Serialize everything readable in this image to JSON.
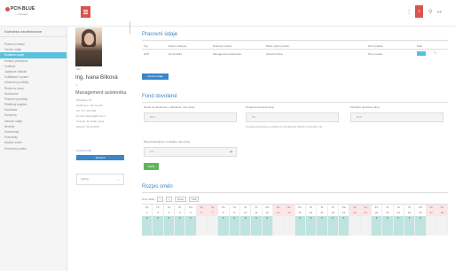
{
  "header": {
    "logo_text": "PCH-BLUE",
    "logo_sub": "software",
    "icons": [
      "grid-icon",
      "bell-icon",
      "user-icon",
      "logout-icon"
    ]
  },
  "sidebar": {
    "title": "Kartoteka zaměstnance",
    "items": [
      {
        "label": "Pracovní vztahy",
        "active": false
      },
      {
        "label": "Osobní údaje",
        "active": false
      },
      {
        "label": "Kontaktní údaje",
        "active": true
      },
      {
        "label": "Rodinní příslušníci",
        "active": false
      },
      {
        "label": "Vzdělání",
        "active": false
      },
      {
        "label": "Jazykové znalosti",
        "active": false
      },
      {
        "label": "Kvalifikace a praxe",
        "active": false
      },
      {
        "label": "Zdravotní prohlídky",
        "active": false
      },
      {
        "label": "Školení a kurzy",
        "active": false
      },
      {
        "label": "Hodnocení",
        "active": false
      },
      {
        "label": "Pracovní pomůcky",
        "active": false
      },
      {
        "label": "Přidělený majetek",
        "active": false
      },
      {
        "label": "Docházka",
        "active": false
      },
      {
        "label": "Dovolená",
        "active": false
      },
      {
        "label": "Mzdové údaje",
        "active": false
      },
      {
        "label": "Benefity",
        "active": false
      },
      {
        "label": "Dokumenty",
        "active": false
      },
      {
        "label": "Poznámky",
        "active": false
      },
      {
        "label": "Historie změn",
        "active": false
      },
      {
        "label": "Ukončení poměru",
        "active": false
      }
    ]
  },
  "profile": {
    "photo_label": "foto",
    "name": "Ing. Ivana Bílková",
    "number": "1",
    "role": "Management asistentka",
    "lines": [
      "Středisko: 01",
      "Nadřízený: Jan Novák",
      "Tel: 777 123 456",
      "E-mail: bilkova@firma.cz",
      "Úvazek: 40 hodin týdně",
      "Nástup: 01.03.2014"
    ],
    "small_link": "Upravit profil",
    "button": "Zobrazit",
    "select_value": "Vybrat"
  },
  "work": {
    "title": "Pracovní údaje",
    "columns": [
      "Typ",
      "Datum nástupu",
      "Pracovní pozice",
      "Místo výkonu práce",
      "Druh úvazku",
      "Stav"
    ],
    "row": [
      "HPP",
      "01.03.2014",
      "Management asistentka",
      "Ústředí Praha",
      "Plný úvazek",
      "aktivní"
    ],
    "button": "Upravit údaje"
  },
  "vacation": {
    "title": "Fond dovolené",
    "field1_label": "Nárok na dovolenou v aktuálním roce (dny)",
    "field1_value": "20,0",
    "field2_label": "Čerpaná dovolená (dny)",
    "field2_value": "5,0",
    "field2_note": "Čerpaná dovolená je počítána ze schválených žádostí za aktuální rok.",
    "field3_label": "Zbývající dovolená (dny)",
    "field3_value": "15,0",
    "field4_label": "Převod dovolené z minulého roku (dny)",
    "field4_value": "0,0",
    "save_button": "Uložit"
  },
  "schedule": {
    "title": "Rozpis směn",
    "month_label": "Únor 2019",
    "prev": "‹",
    "next": "›",
    "today_button": "Dnes",
    "print_button": "Tisk",
    "days": [
      {
        "wd": "Po",
        "d": "1",
        "v": "8",
        "we": false
      },
      {
        "wd": "Út",
        "d": "2",
        "v": "8",
        "we": false
      },
      {
        "wd": "St",
        "d": "3",
        "v": "8",
        "we": false
      },
      {
        "wd": "Čt",
        "d": "4",
        "v": "8",
        "we": false
      },
      {
        "wd": "Pá",
        "d": "5",
        "v": "8",
        "we": false
      },
      {
        "wd": "So",
        "d": "6",
        "v": "",
        "we": true
      },
      {
        "wd": "Ne",
        "d": "7",
        "v": "",
        "we": true
      },
      {
        "wd": "Po",
        "d": "8",
        "v": "8",
        "we": false
      },
      {
        "wd": "Út",
        "d": "9",
        "v": "8",
        "we": false
      },
      {
        "wd": "St",
        "d": "10",
        "v": "8",
        "we": false
      },
      {
        "wd": "Čt",
        "d": "11",
        "v": "8",
        "we": false
      },
      {
        "wd": "Pá",
        "d": "12",
        "v": "8",
        "we": false
      },
      {
        "wd": "So",
        "d": "13",
        "v": "",
        "we": true
      },
      {
        "wd": "Ne",
        "d": "14",
        "v": "",
        "we": true
      },
      {
        "wd": "Po",
        "d": "15",
        "v": "8",
        "we": false
      },
      {
        "wd": "Út",
        "d": "16",
        "v": "8",
        "we": false
      },
      {
        "wd": "St",
        "d": "17",
        "v": "8",
        "we": false
      },
      {
        "wd": "Čt",
        "d": "18",
        "v": "8",
        "we": false
      },
      {
        "wd": "Pá",
        "d": "19",
        "v": "8",
        "we": false
      },
      {
        "wd": "So",
        "d": "20",
        "v": "",
        "we": true
      },
      {
        "wd": "Ne",
        "d": "21",
        "v": "",
        "we": true
      },
      {
        "wd": "Po",
        "d": "22",
        "v": "8",
        "we": false
      },
      {
        "wd": "Út",
        "d": "23",
        "v": "8",
        "we": false
      },
      {
        "wd": "St",
        "d": "24",
        "v": "8",
        "we": false
      },
      {
        "wd": "Čt",
        "d": "25",
        "v": "8",
        "we": false
      },
      {
        "wd": "Pá",
        "d": "26",
        "v": "8",
        "we": false
      },
      {
        "wd": "So",
        "d": "27",
        "v": "",
        "we": true
      },
      {
        "wd": "Ne",
        "d": "28",
        "v": "",
        "we": true
      }
    ]
  },
  "colors": {
    "accent_red": "#d9534f",
    "primary_blue": "#3a86c8",
    "sidebar_active": "#5bc0de",
    "success_green": "#5cb85c",
    "shift_teal": "#bfe3df"
  }
}
